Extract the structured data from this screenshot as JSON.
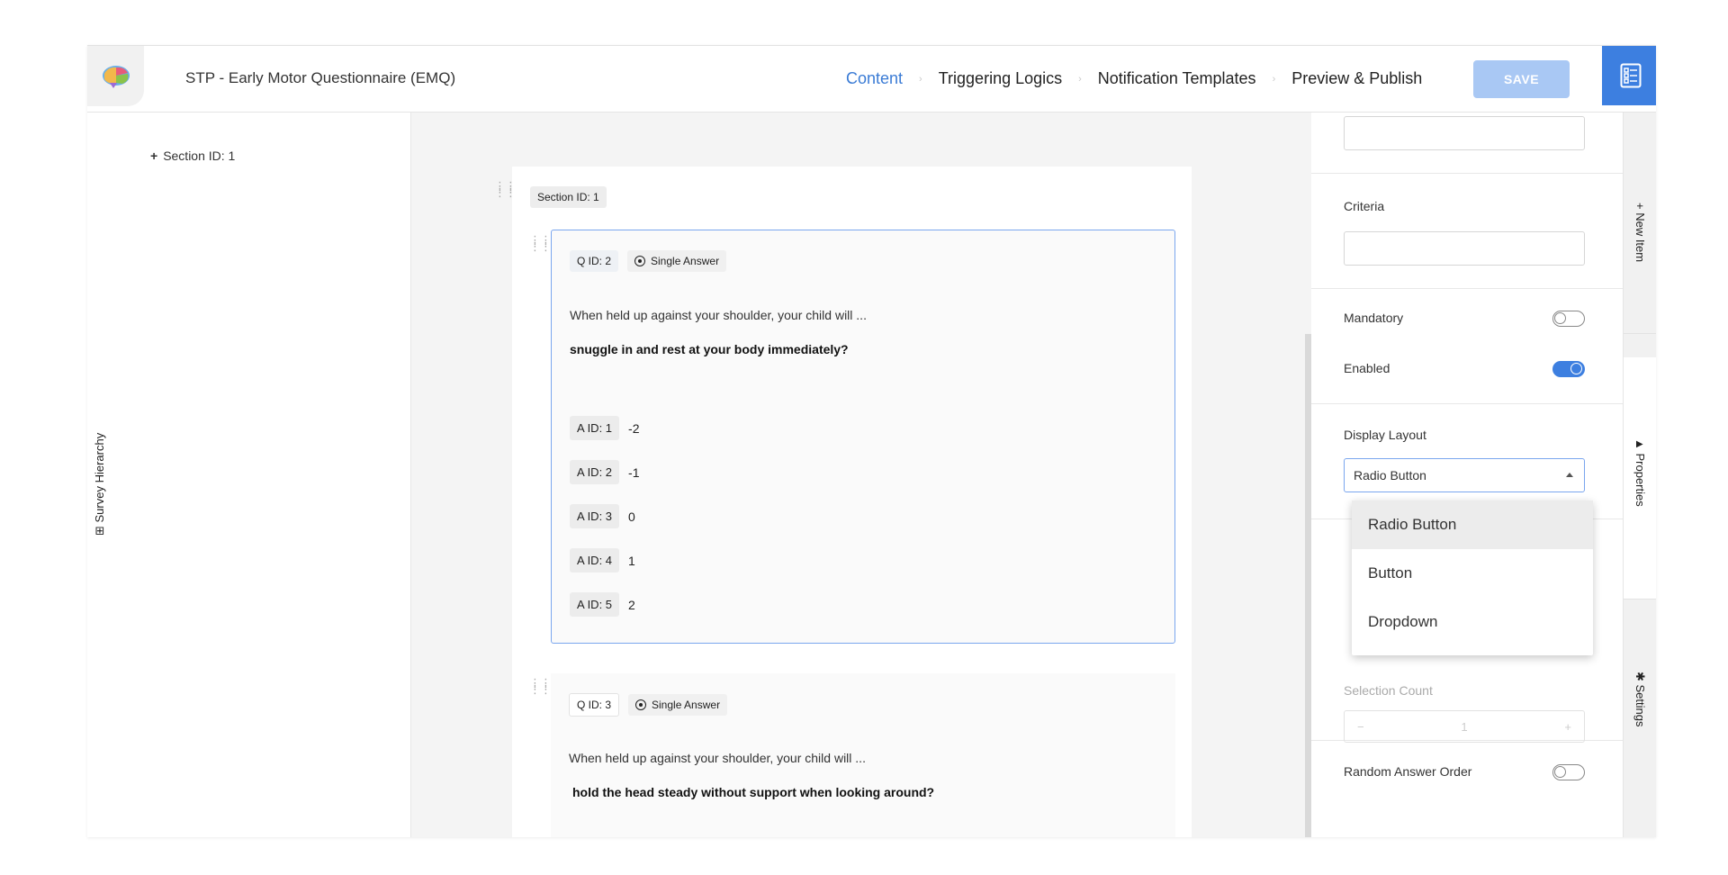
{
  "header": {
    "title": "STP - Early Motor Questionnaire (EMQ)",
    "tabs": [
      {
        "label": "Content"
      },
      {
        "label": "Triggering Logics"
      },
      {
        "label": "Notification Templates"
      },
      {
        "label": "Preview & Publish"
      }
    ],
    "save_label": "SAVE"
  },
  "hierarchy": {
    "label": "Survey Hierarchy",
    "items": [
      {
        "label": "Section ID: 1"
      }
    ]
  },
  "canvas": {
    "section_label": "Section ID: 1",
    "questions": [
      {
        "qid": "Q ID: 2",
        "type": "Single Answer",
        "prompt": "When held up against your shoulder, your child will ...",
        "text": "snuggle in and rest at your body immediately?",
        "answers": [
          {
            "aid": "A ID: 1",
            "value": "-2"
          },
          {
            "aid": "A ID: 2",
            "value": "-1"
          },
          {
            "aid": "A ID: 3",
            "value": "0"
          },
          {
            "aid": "A ID: 4",
            "value": "1"
          },
          {
            "aid": "A ID: 5",
            "value": "2"
          }
        ]
      },
      {
        "qid": "Q ID: 3",
        "type": "Single Answer",
        "prompt": "When held up against your shoulder, your child will ...",
        "text": "hold the head steady without support when looking around?"
      }
    ]
  },
  "properties": {
    "criteria_label": "Criteria",
    "mandatory_label": "Mandatory",
    "enabled_label": "Enabled",
    "display_layout_label": "Display Layout",
    "display_layout_value": "Radio Button",
    "display_layout_options": [
      "Radio Button",
      "Button",
      "Dropdown"
    ],
    "selection_count_label": "Selection Count",
    "selection_count_value": "1",
    "random_order_label": "Random Answer Order",
    "stepper_minus": "−",
    "stepper_plus": "+"
  },
  "side_tabs": {
    "new_item": "+ New Item",
    "properties": "Properties",
    "settings": "Settings"
  },
  "colors": {
    "accent": "#3d7fe0",
    "save_disabled": "#a9c8f4",
    "selected_border": "#7aa6ee"
  }
}
